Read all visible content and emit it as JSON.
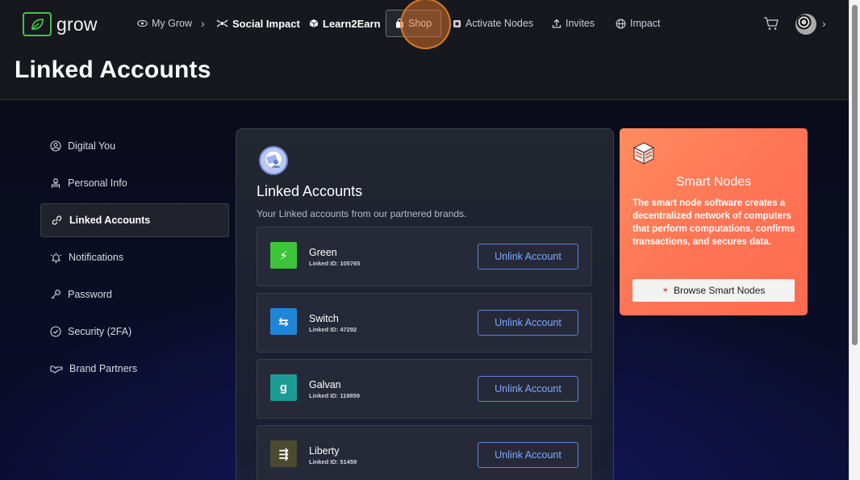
{
  "header": {
    "logo_text": "grow",
    "page_title": "Linked Accounts",
    "nav": [
      {
        "label": "My Grow",
        "icon": "eye-icon",
        "has_chevron": true
      },
      {
        "label": "Social Impact",
        "icon": "network-icon"
      },
      {
        "label": "Learn2Earn",
        "icon": "cube-icon"
      },
      {
        "label": "Shop",
        "icon": "shopping-bag-icon"
      },
      {
        "label": "Activate Nodes",
        "icon": "node-icon"
      },
      {
        "label": "Invites",
        "icon": "upload-icon"
      },
      {
        "label": "Impact",
        "icon": "globe-icon"
      }
    ]
  },
  "sidebar": {
    "items": [
      {
        "label": "Digital You",
        "icon": "user-circle-icon"
      },
      {
        "label": "Personal Info",
        "icon": "id-badge-icon"
      },
      {
        "label": "Linked Accounts",
        "icon": "link-icon",
        "active": true
      },
      {
        "label": "Notifications",
        "icon": "bell-icon"
      },
      {
        "label": "Password",
        "icon": "key-icon"
      },
      {
        "label": "Security (2FA)",
        "icon": "shield-check-icon"
      },
      {
        "label": "Brand Partners",
        "icon": "handshake-icon"
      }
    ]
  },
  "main": {
    "title": "Linked Accounts",
    "subtitle": "Your Linked accounts from our partnered brands.",
    "button_label": "Unlink Account",
    "accounts": [
      {
        "name": "Green",
        "linked_id": "Linked ID: 105765",
        "logo_color": "#3cc43a",
        "logo_glyph": "⚡"
      },
      {
        "name": "Switch",
        "linked_id": "Linked ID: 47292",
        "logo_color": "#1f86d6",
        "logo_glyph": "⇆"
      },
      {
        "name": "Galvan",
        "linked_id": "Linked ID: 119859",
        "logo_color": "#1c9b94",
        "logo_glyph": "g"
      },
      {
        "name": "Liberty",
        "linked_id": "Linked ID: 51459",
        "logo_color": "#4b4a30",
        "logo_glyph": "⇶"
      }
    ]
  },
  "promo": {
    "title": "Smart Nodes",
    "description": "The smart node software creates a decentralized network of computers that perform computations, confirms transactions, and secures data.",
    "button_label": "Browse Smart Nodes",
    "gradient_color": "#ff7555"
  },
  "colors": {
    "accent_green": "#3ec24c",
    "link_blue": "#7fa6ff",
    "header_bg": "#16181e"
  }
}
